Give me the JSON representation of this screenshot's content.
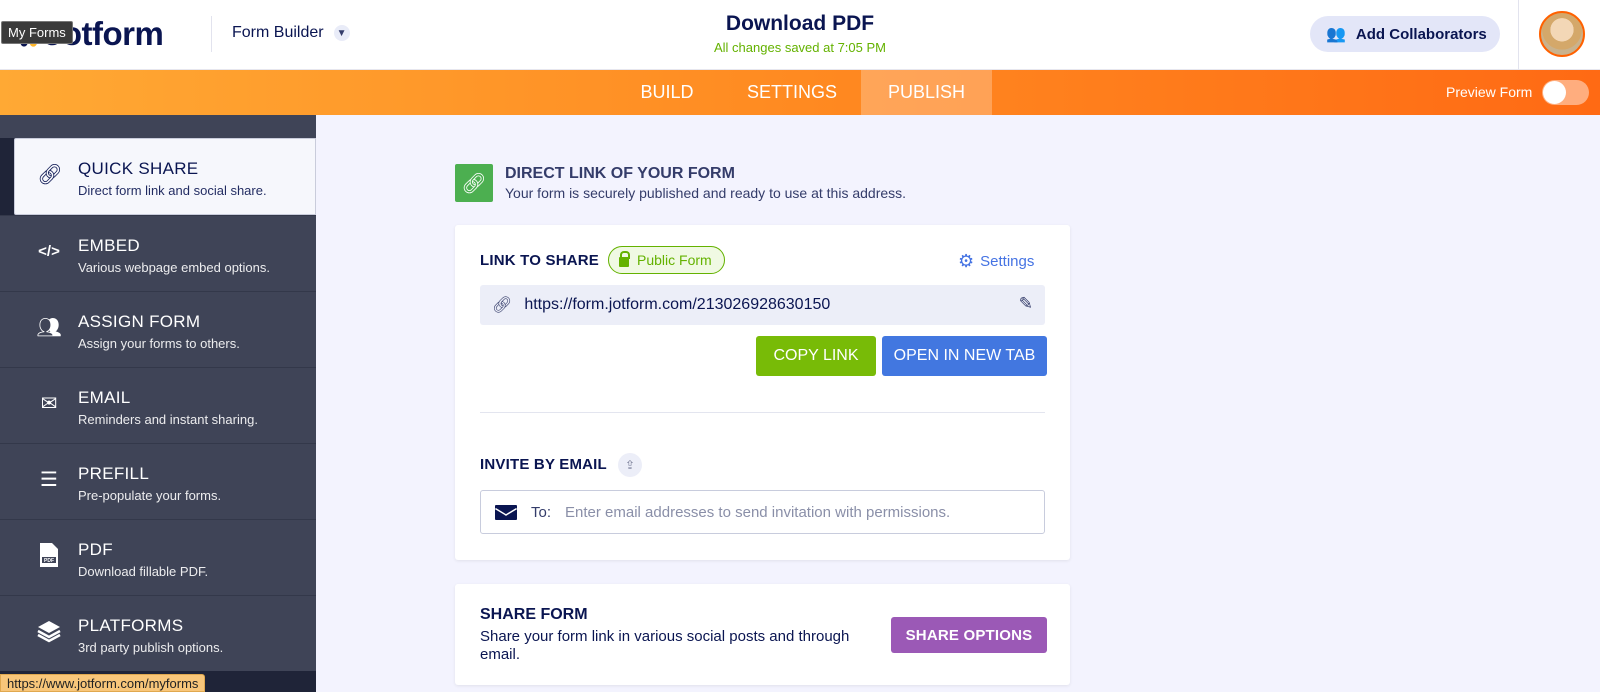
{
  "header": {
    "logo_text": "Jotform",
    "tooltip": "My Forms",
    "builder_label": "Form Builder",
    "title": "Download PDF",
    "save_status": "All changes saved at 7:05 PM",
    "collaborators_label": "Add Collaborators"
  },
  "nav": {
    "tabs": [
      "BUILD",
      "SETTINGS",
      "PUBLISH"
    ],
    "active_tab": "PUBLISH",
    "preview_label": "Preview Form",
    "preview_enabled": false
  },
  "sidebar": {
    "items": [
      {
        "title": "QUICK SHARE",
        "desc": "Direct form link and social share.",
        "icon": "link-icon",
        "active": true
      },
      {
        "title": "EMBED",
        "desc": "Various webpage embed options.",
        "icon": "code-icon"
      },
      {
        "title": "ASSIGN FORM",
        "desc": "Assign your forms to others.",
        "icon": "users-icon"
      },
      {
        "title": "EMAIL",
        "desc": "Reminders and instant sharing.",
        "icon": "envelope-icon"
      },
      {
        "title": "PREFILL",
        "desc": "Pre-populate your forms.",
        "icon": "prefill-icon"
      },
      {
        "title": "PDF",
        "desc": "Download fillable PDF.",
        "icon": "pdf-icon"
      },
      {
        "title": "PLATFORMS",
        "desc": "3rd party publish options.",
        "icon": "layers-icon"
      }
    ]
  },
  "status_bar": {
    "url": "https://www.jotform.com/myforms"
  },
  "direct_link": {
    "title": "DIRECT LINK OF YOUR FORM",
    "subtitle": "Your form is securely published and ready to use at this address."
  },
  "link_card": {
    "label": "LINK TO SHARE",
    "badge": "Public Form",
    "settings_label": "Settings",
    "url": "https://form.jotform.com/213026928630150",
    "copy_label": "COPY LINK",
    "open_label": "OPEN IN NEW TAB",
    "invite_label": "INVITE BY EMAIL",
    "to_label": "To:",
    "email_placeholder": "Enter email addresses to send invitation with permissions."
  },
  "share_card": {
    "title": "SHARE FORM",
    "desc": "Share your form link in various social posts and through email.",
    "button_label": "SHARE OPTIONS"
  },
  "colors": {
    "accent_orange": "#ff8a21",
    "green": "#78bb07",
    "blue": "#4277e0",
    "purple": "#9b59b6",
    "sidebar_bg": "#3f4457"
  }
}
